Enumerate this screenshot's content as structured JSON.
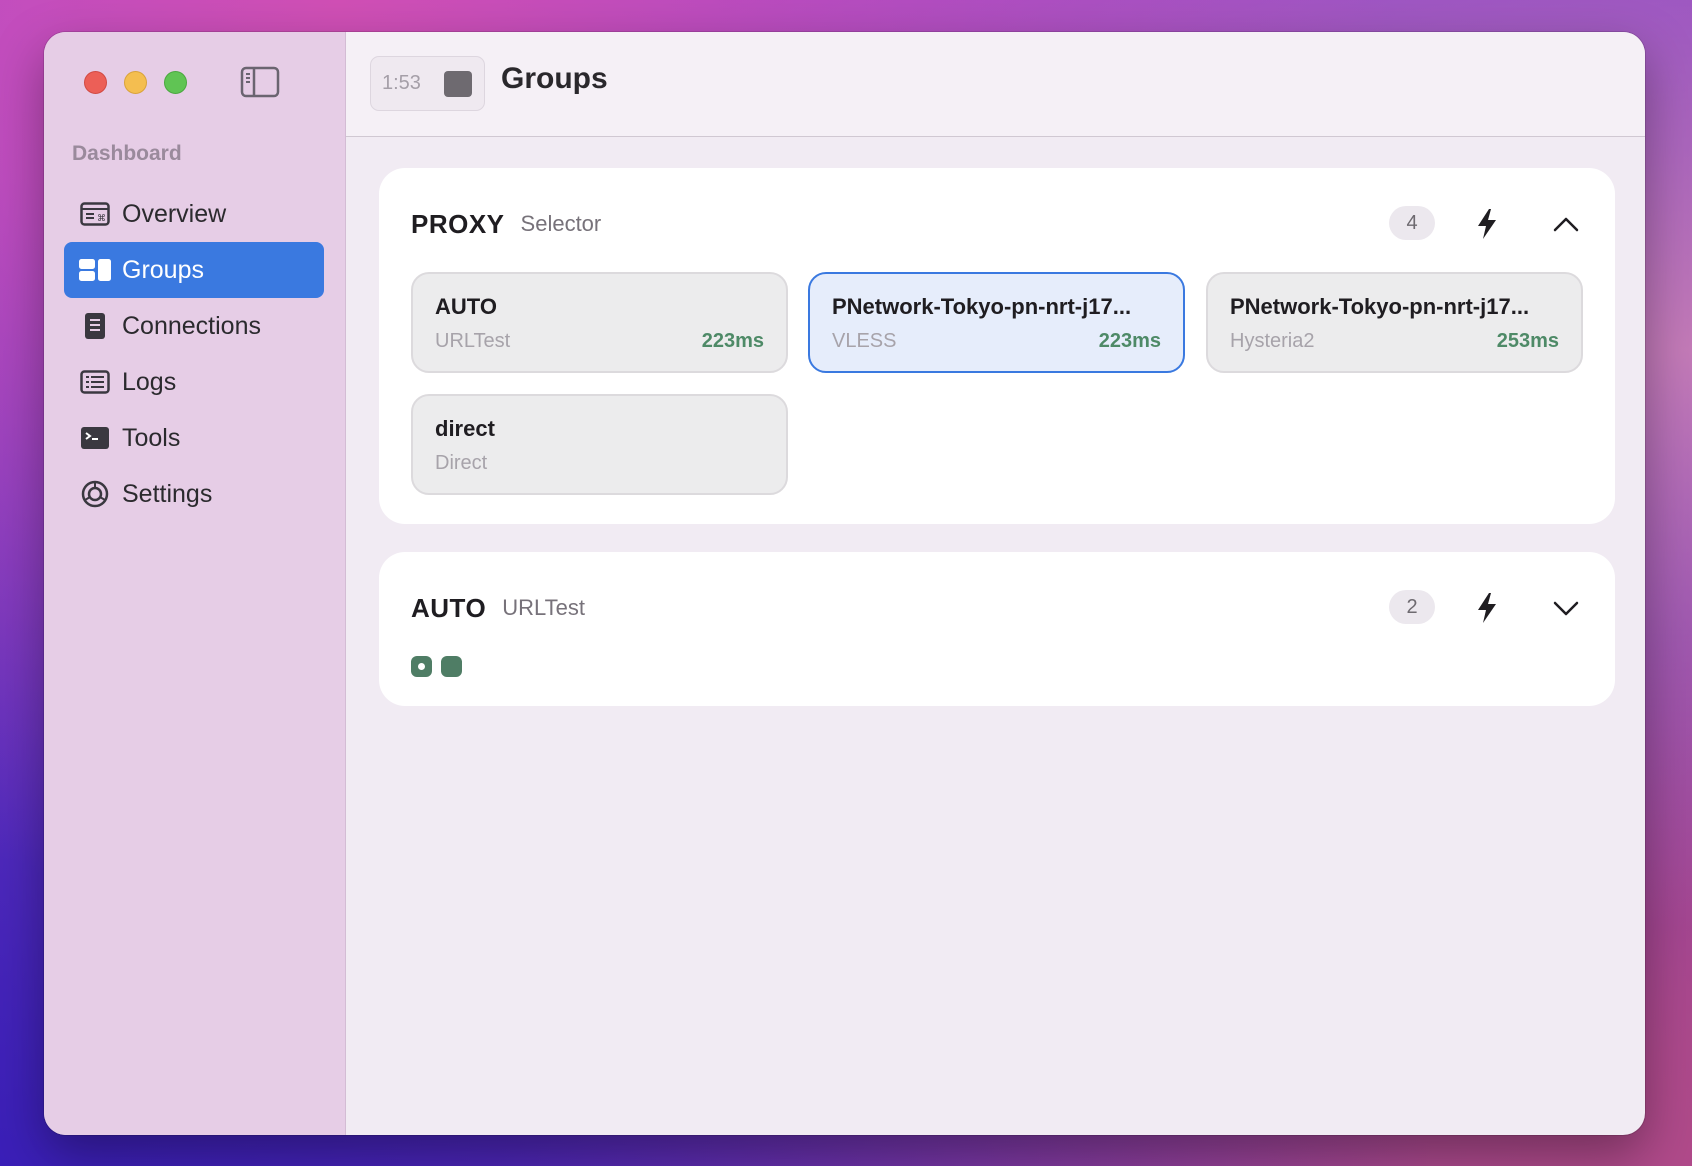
{
  "sidebar": {
    "section": "Dashboard",
    "items": [
      {
        "label": "Overview",
        "icon": "overview-icon",
        "active": false
      },
      {
        "label": "Groups",
        "icon": "groups-icon",
        "active": true
      },
      {
        "label": "Connections",
        "icon": "connections-icon",
        "active": false
      },
      {
        "label": "Logs",
        "icon": "logs-icon",
        "active": false
      },
      {
        "label": "Tools",
        "icon": "terminal-icon",
        "active": false
      },
      {
        "label": "Settings",
        "icon": "gear-icon",
        "active": false
      }
    ]
  },
  "toolbar": {
    "timer": "1:53",
    "title": "Groups"
  },
  "groups": [
    {
      "name": "PROXY",
      "type": "Selector",
      "count": "4",
      "expanded": true,
      "nodes": [
        {
          "name": "AUTO",
          "type": "URLTest",
          "delay": "223ms",
          "selected": false
        },
        {
          "name": "PNetwork-Tokyo-pn-nrt-j17...",
          "type": "VLESS",
          "delay": "223ms",
          "selected": true
        },
        {
          "name": "PNetwork-Tokyo-pn-nrt-j17...",
          "type": "Hysteria2",
          "delay": "253ms",
          "selected": false
        },
        {
          "name": "direct",
          "type": "Direct",
          "delay": "",
          "selected": false
        }
      ]
    },
    {
      "name": "AUTO",
      "type": "URLTest",
      "count": "2",
      "expanded": false,
      "nodes": []
    }
  ],
  "colors": {
    "accent": "#3a79e0",
    "delay_good": "#4e8a67",
    "sidebar_bg": "#e6cde6"
  }
}
